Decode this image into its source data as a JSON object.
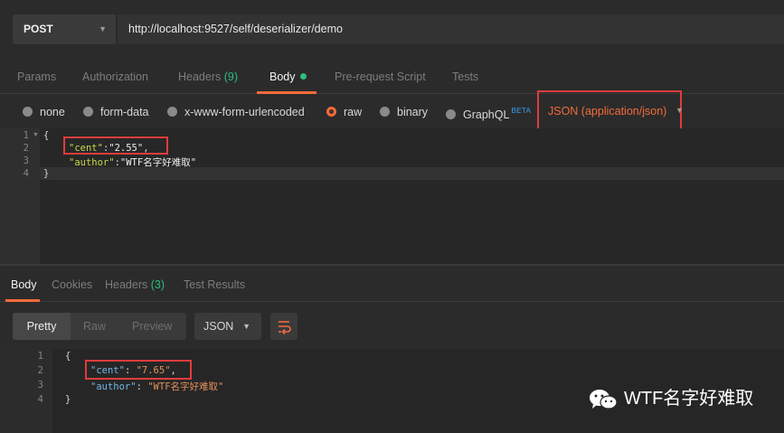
{
  "request": {
    "method": "POST",
    "url": "http://localhost:9527/self/deserializer/demo",
    "tabs": [
      {
        "label": "Params"
      },
      {
        "label": "Authorization"
      },
      {
        "label": "Headers",
        "count": "(9)"
      },
      {
        "label": "Body",
        "active": true
      },
      {
        "label": "Pre-request Script"
      },
      {
        "label": "Tests"
      }
    ],
    "body_types": [
      {
        "label": "none"
      },
      {
        "label": "form-data"
      },
      {
        "label": "x-www-form-urlencoded"
      },
      {
        "label": "raw",
        "selected": true
      },
      {
        "label": "binary"
      },
      {
        "label": "GraphQL",
        "badge": "BETA"
      }
    ],
    "content_type": "JSON (application/json)",
    "editor_lines": [
      "1",
      "2",
      "3",
      "4"
    ],
    "body_code": {
      "l1": "{",
      "l2_key": "\"cent\"",
      "l2_colon": ":",
      "l2_val": "\"2.55\"",
      "l2_comma": ",",
      "l3_key": "\"author\"",
      "l3_colon": ":",
      "l3_val": "\"WTF名字好难取\"",
      "l4": "}"
    }
  },
  "response": {
    "tabs": [
      {
        "label": "Body",
        "active": true
      },
      {
        "label": "Cookies"
      },
      {
        "label": "Headers",
        "count": "(3)"
      },
      {
        "label": "Test Results"
      }
    ],
    "view_modes": [
      "Pretty",
      "Raw",
      "Preview"
    ],
    "format": "JSON",
    "editor_lines": [
      "1",
      "2",
      "3",
      "4"
    ],
    "body_code": {
      "l1": "{",
      "l2_key": "\"cent\"",
      "l2_colon": ": ",
      "l2_val": "\"7.65\"",
      "l2_comma": ",",
      "l3_key": "\"author\"",
      "l3_colon": ": ",
      "l3_val": "\"WTF名字好难取\"",
      "l4": "}"
    }
  },
  "watermark": "WTF名字好难取",
  "colors": {
    "accent": "#f26b3a",
    "highlight_box": "#e03c3c",
    "count_green": "#2bbf7e"
  }
}
